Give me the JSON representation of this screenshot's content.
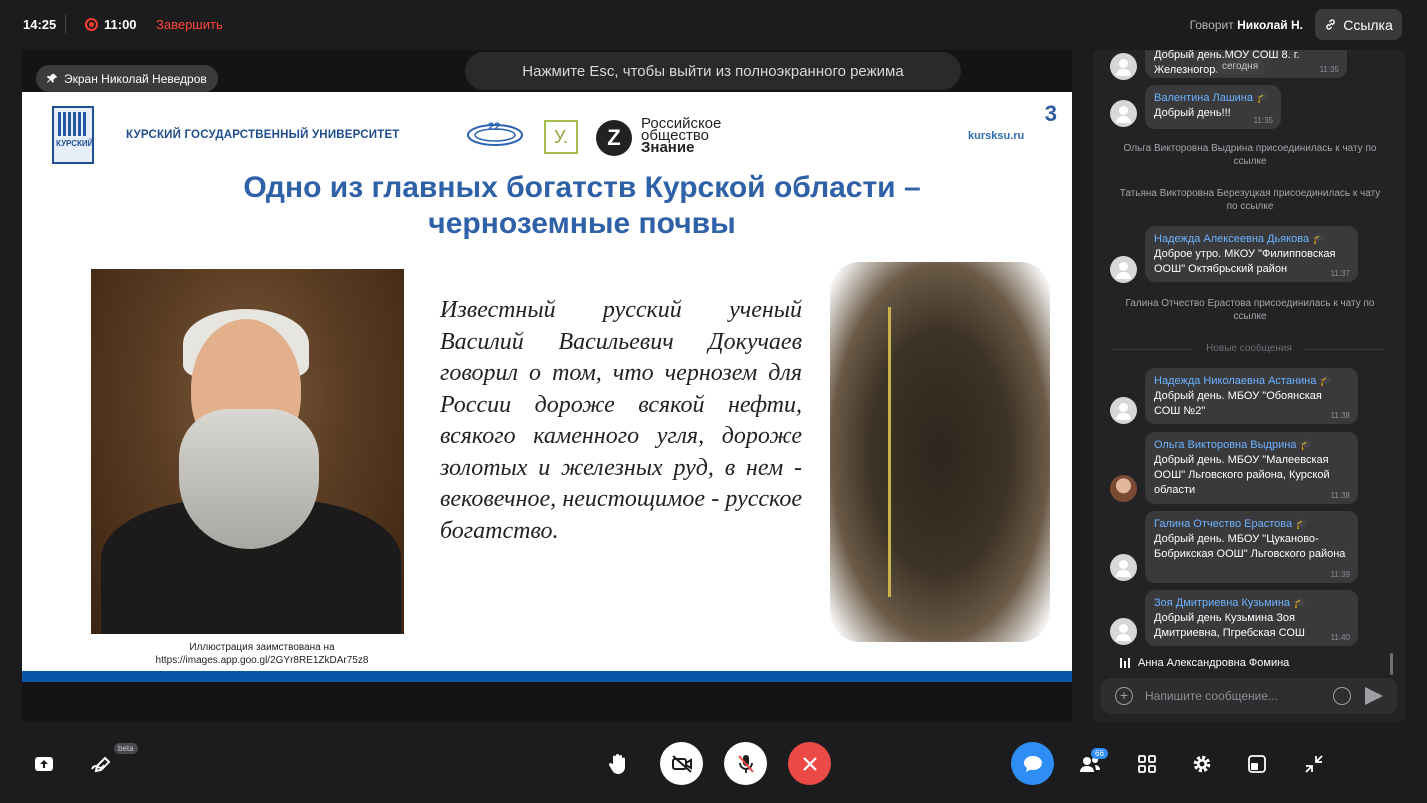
{
  "topbar": {
    "clock": "14:25",
    "recording_time": "11:00",
    "finish_label": "Завершить",
    "speaking_prefix": "Говорит",
    "speaking_name": "Николай Н.",
    "link_label": "Ссылка"
  },
  "stage": {
    "screen_label": "Экран Николай Неведров",
    "esc_hint": "Нажмите Esc, чтобы выйти из полноэкранного режима"
  },
  "slide": {
    "number": "3",
    "university_logo_text": "КУРСКИЙ",
    "university_name": "КУРСКИЙ ГОСУДАРСТВЕННЫЙ УНИВЕРСИТЕТ",
    "society_line1": "Российское",
    "society_line2": "общество",
    "society_line3": "Знание",
    "site": "kursksu.ru",
    "title_line1": "Одно из главных богатств Курской области –",
    "title_line2": "черноземные почвы",
    "quote": "Известный русский ученый Василий Васильевич Докучаев говорил о том, что чернозем для России дороже всякой нефти, всякого каменного угля, дороже золотых и железных руд, в нем - вековечное, неистощимое - русское богатство.",
    "caption_line1": "Иллюстрация заимствована на",
    "caption_line2": "https://images.app.goo.gl/2GYr8RE1ZkDAr75z8"
  },
  "chat": {
    "date_chip": "сегодня",
    "messages_top": [
      {
        "name": "",
        "text": "Добрый день.МОУ СОШ 8. г. Железногорск",
        "time": "11:35"
      },
      {
        "name": "Валентина Лашина",
        "text": "Добрый день!!!",
        "time": "11:35"
      }
    ],
    "system": [
      {
        "name": "Ольга Викторовна Выдрина",
        "text": "присоединилась к чату по ссылке"
      },
      {
        "name": "Татьяна Викторовна Березуцкая",
        "text": "присоединилась к чату по ссылке"
      },
      {
        "name": "Галина Отчество Ерастова",
        "text": "присоединилась к чату по ссылке"
      }
    ],
    "msg_dyakova": {
      "name": "Надежда Алексеевна Дьякова",
      "text": "Доброе утро. МКОУ \"Филипповская ООШ\" Октябрьский район",
      "time": "11:37"
    },
    "new_messages_label": "Новые сообщения",
    "messages_new": [
      {
        "name": "Надежда Николаевна Астанина",
        "text": "Добрый день. МБОУ \"Обоянская СОШ №2\"",
        "time": "11:38"
      },
      {
        "name": "Ольга Викторовна Выдрина",
        "text": "Добрый день. МБОУ \"Малеевская ООШ\" Льговского района, Курской области",
        "time": "11:38"
      },
      {
        "name": "Галина Отчество Ерастова",
        "text": "Добрый день. МБОУ \"Цуканово-Бобрикская ООШ\" Льговского района",
        "time": "11:39"
      },
      {
        "name": "Зоя Дмитриевна Кузьмина",
        "text": "Добрый день Кузьмина Зоя Дмитриевна, Пгребская СОШ",
        "time": "11:40"
      }
    ],
    "typing_name": "Анна Александровна Фомина",
    "input_placeholder": "Напишите сообщение..."
  },
  "bottom": {
    "beta_label": "beta",
    "participants_count": "66"
  },
  "colors": {
    "accent_blue": "#2e8ef5",
    "end_red": "#eb4a46",
    "name_blue": "#6db3ff",
    "slide_title": "#2e61a8"
  },
  "icons": [
    "pin-icon",
    "link-icon",
    "share-screen-icon",
    "draw-icon",
    "hand-icon",
    "camera-off-icon",
    "mic-off-icon",
    "close-icon",
    "chat-icon",
    "participants-icon",
    "grid-icon",
    "gear-icon",
    "layout-icon",
    "exit-fullscreen-icon",
    "school-cap-icon",
    "add-icon",
    "emoji-icon",
    "send-icon"
  ]
}
